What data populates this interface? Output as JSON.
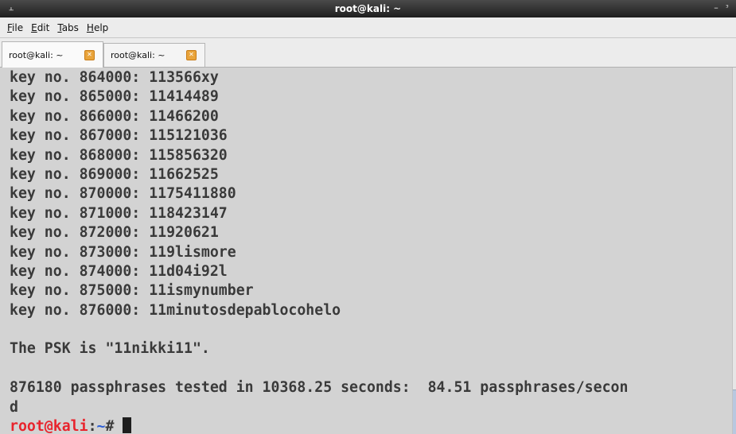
{
  "window": {
    "title": "root@kali: ~",
    "app_icon": "terminal-icon",
    "controls": [
      "minimize",
      "maximize"
    ]
  },
  "menubar": {
    "items": [
      {
        "label": "File",
        "mnemonic": "F",
        "rest": "ile"
      },
      {
        "label": "Edit",
        "mnemonic": "E",
        "rest": "dit"
      },
      {
        "label": "Tabs",
        "mnemonic": "T",
        "rest": "abs"
      },
      {
        "label": "Help",
        "mnemonic": "H",
        "rest": "elp"
      }
    ]
  },
  "tabs": [
    {
      "label": "root@kali: ~",
      "active": true,
      "close_icon": "close-icon"
    },
    {
      "label": "root@kali: ~",
      "active": false,
      "close_icon": "close-icon"
    }
  ],
  "terminal": {
    "lines": [
      "key no. 864000: 113566xy",
      "key no. 865000: 11414489",
      "key no. 866000: 11466200",
      "key no. 867000: 115121036",
      "key no. 868000: 115856320",
      "key no. 869000: 11662525",
      "key no. 870000: 1175411880",
      "key no. 871000: 118423147",
      "key no. 872000: 11920621",
      "key no. 873000: 119lismore",
      "key no. 874000: 11d04i92l",
      "key no. 875000: 11ismynumber",
      "key no. 876000: 11minutosdepablocohelo",
      "",
      "The PSK is \"11nikki11\".",
      "",
      "876180 passphrases tested in 10368.25 seconds:  84.51 passphrases/secon",
      "d"
    ],
    "prompt": {
      "user_host": "root@kali",
      "separator": ":",
      "path": "~",
      "symbol": "# "
    }
  },
  "colors": {
    "terminal_bg": "#d3d3d3",
    "terminal_fg": "#3a3a3a",
    "prompt_user": "#e8242d",
    "prompt_path": "#2d5fd6",
    "tab_close": "#e9a43b"
  }
}
